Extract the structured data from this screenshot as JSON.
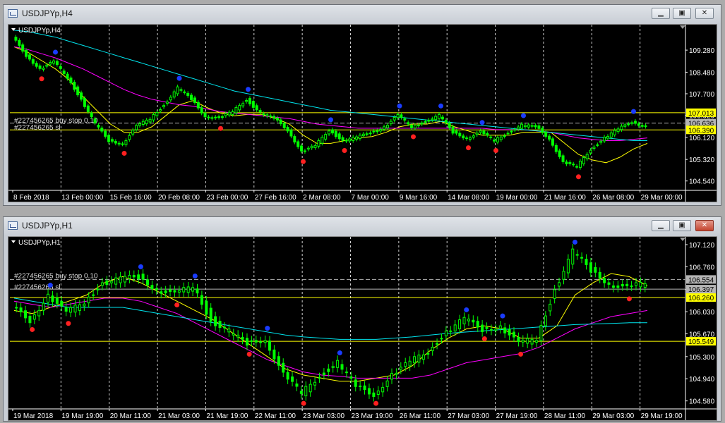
{
  "windows": [
    {
      "title": "USDJPYp,H4",
      "chart_label": "USDJPYp,H4",
      "chart_data": {
        "type": "candlestick",
        "ylim": [
          104.2,
          110.1
        ],
        "yticks": [
          "109.280",
          "108.480",
          "107.700",
          "106.920",
          "106.120",
          "105.320",
          "104.540"
        ],
        "xticks": [
          "8 Feb 2018",
          "13 Feb 00:00",
          "15 Feb 16:00",
          "20 Feb 08:00",
          "23 Feb 00:00",
          "27 Feb 16:00",
          "2 Mar 08:00",
          "7 Mar 00:00",
          "9 Mar 16:00",
          "14 Mar 08:00",
          "19 Mar 00:00",
          "21 Mar 16:00",
          "26 Mar 08:00",
          "29 Mar 00:00"
        ],
        "hlines": [
          {
            "value": 107.013,
            "label": "107.013",
            "color": "#ffff00",
            "style": "solid"
          },
          {
            "value": 106.636,
            "label": "106.636",
            "color": "#b5b5b5",
            "style": "dash"
          },
          {
            "value": 106.39,
            "label": "106.390",
            "color": "#ffff00",
            "style": "solid"
          }
        ],
        "order_labels": [
          "#227456265 buy stop 0.10",
          "#227456265 sl"
        ],
        "series": [
          {
            "name": "close",
            "color": "#00ff00",
            "values": [
              109.75,
              109.1,
              108.6,
              108.85,
              108.3,
              107.5,
              106.6,
              106.0,
              105.9,
              106.5,
              106.8,
              107.3,
              107.9,
              107.5,
              106.9,
              106.8,
              107.05,
              107.5,
              107.0,
              106.8,
              106.4,
              105.6,
              105.8,
              106.4,
              106.0,
              106.1,
              106.3,
              106.5,
              106.9,
              106.5,
              106.7,
              106.9,
              106.3,
              106.1,
              106.3,
              106.0,
              106.3,
              106.55,
              106.5,
              106.1,
              105.2,
              105.05,
              105.7,
              106.1,
              106.4,
              106.7,
              106.5
            ]
          },
          {
            "name": "ma-fast",
            "color": "#ffff00",
            "values": [
              109.4,
              109.2,
              108.9,
              108.6,
              108.2,
              107.6,
              107.1,
              106.6,
              106.3,
              106.3,
              106.5,
              106.9,
              107.3,
              107.45,
              107.2,
              107.0,
              106.9,
              106.95,
              106.95,
              106.8,
              106.6,
              106.2,
              105.9,
              105.9,
              106.0,
              106.1,
              106.15,
              106.3,
              106.5,
              106.6,
              106.6,
              106.7,
              106.5,
              106.35,
              106.2,
              106.2,
              106.2,
              106.3,
              106.3,
              106.3,
              105.9,
              105.5,
              105.3,
              105.2,
              105.4,
              105.7,
              105.9
            ]
          },
          {
            "name": "ma-mid",
            "color": "#ff00ff",
            "values": [
              109.4,
              109.3,
              109.15,
              109.0,
              108.8,
              108.6,
              108.35,
              108.1,
              107.85,
              107.65,
              107.5,
              107.4,
              107.3,
              107.25,
              107.15,
              107.05,
              107.0,
              106.95,
              106.9,
              106.85,
              106.8,
              106.7,
              106.6,
              106.55,
              106.5,
              106.45,
              106.45,
              106.45,
              106.45,
              106.45,
              106.45,
              106.45,
              106.45,
              106.45,
              106.45,
              106.4,
              106.4,
              106.4,
              106.35,
              106.3,
              106.2,
              106.1,
              106.05,
              106.0,
              106.0,
              106.05,
              106.1
            ]
          },
          {
            "name": "ma-slow",
            "color": "#00e5ee",
            "values": [
              110.0,
              109.95,
              109.85,
              109.75,
              109.6,
              109.45,
              109.3,
              109.15,
              109.0,
              108.85,
              108.7,
              108.55,
              108.4,
              108.25,
              108.1,
              107.95,
              107.8,
              107.7,
              107.6,
              107.5,
              107.4,
              107.3,
              107.2,
              107.1,
              107.05,
              107.0,
              106.95,
              106.9,
              106.85,
              106.8,
              106.75,
              106.7,
              106.65,
              106.6,
              106.55,
              106.5,
              106.45,
              106.4,
              106.35,
              106.3,
              106.25,
              106.2,
              106.15,
              106.1,
              106.05,
              106.0,
              106.0
            ]
          }
        ]
      }
    },
    {
      "title": "USDJPYp,H1",
      "chart_label": "USDJPYp,H1",
      "chart_data": {
        "type": "candlestick",
        "ylim": [
          104.45,
          107.2
        ],
        "yticks": [
          "107.120",
          "106.760",
          "106.390",
          "106.030",
          "105.670",
          "105.300",
          "104.940",
          "104.580"
        ],
        "xticks": [
          "19 Mar 2018",
          "19 Mar 19:00",
          "20 Mar 11:00",
          "21 Mar 03:00",
          "21 Mar 19:00",
          "22 Mar 11:00",
          "23 Mar 03:00",
          "23 Mar 19:00",
          "26 Mar 11:00",
          "27 Mar 03:00",
          "27 Mar 19:00",
          "28 Mar 11:00",
          "29 Mar 03:00",
          "29 Mar 19:00"
        ],
        "hlines": [
          {
            "value": 106.554,
            "label": "106.554",
            "color": "#b5b5b5",
            "style": "dash"
          },
          {
            "value": 106.397,
            "label": "106.397",
            "color": "#b5b5b5",
            "style": "solid"
          },
          {
            "value": 106.26,
            "label": "106.260",
            "color": "#ffff00",
            "style": "solid"
          },
          {
            "value": 105.549,
            "label": "105.549",
            "color": "#ffff00",
            "style": "solid"
          }
        ],
        "order_labels": [
          "#227456265 buy stop 0.10",
          "#227456265 sl"
        ],
        "series": [
          {
            "name": "close",
            "color": "#00ff00",
            "values": [
              106.1,
              105.9,
              106.3,
              106.0,
              106.2,
              106.5,
              106.55,
              106.6,
              106.4,
              106.3,
              106.45,
              105.9,
              105.7,
              105.5,
              105.6,
              105.0,
              104.7,
              105.0,
              105.2,
              104.8,
              104.7,
              105.0,
              105.2,
              105.4,
              105.7,
              105.9,
              105.75,
              105.8,
              105.5,
              105.6,
              106.4,
              107.0,
              106.7,
              106.5,
              106.4,
              106.5
            ]
          },
          {
            "name": "ma-fast",
            "color": "#ffff00",
            "values": [
              106.05,
              106.0,
              106.1,
              106.2,
              106.3,
              106.5,
              106.6,
              106.5,
              106.35,
              106.2,
              106.05,
              105.9,
              105.7,
              105.5,
              105.3,
              105.1,
              105.0,
              104.95,
              104.9,
              104.9,
              104.95,
              105.0,
              105.15,
              105.4,
              105.6,
              105.75,
              105.8,
              105.75,
              105.6,
              105.6,
              105.8,
              106.3,
              106.5,
              106.65,
              106.6,
              106.45
            ]
          },
          {
            "name": "ma-mid",
            "color": "#ff00ff",
            "values": [
              106.2,
              106.15,
              106.1,
              106.15,
              106.2,
              106.25,
              106.25,
              106.2,
              106.1,
              106.0,
              105.85,
              105.7,
              105.55,
              105.4,
              105.25,
              105.15,
              105.05,
              105.0,
              104.98,
              104.95,
              104.95,
              104.95,
              104.95,
              105.0,
              105.1,
              105.2,
              105.25,
              105.3,
              105.35,
              105.45,
              105.6,
              105.75,
              105.85,
              105.95,
              106.0,
              106.05
            ]
          },
          {
            "name": "ma-slow",
            "color": "#00e5ee",
            "values": [
              106.25,
              106.2,
              106.15,
              106.1,
              106.1,
              106.1,
              106.1,
              106.05,
              106.0,
              105.95,
              105.9,
              105.85,
              105.8,
              105.75,
              105.7,
              105.65,
              105.62,
              105.6,
              105.58,
              105.58,
              105.58,
              105.6,
              105.62,
              105.65,
              105.68,
              105.7,
              105.72,
              105.74,
              105.76,
              105.78,
              105.8,
              105.82,
              105.83,
              105.84,
              105.85,
              105.85
            ]
          }
        ]
      }
    }
  ]
}
